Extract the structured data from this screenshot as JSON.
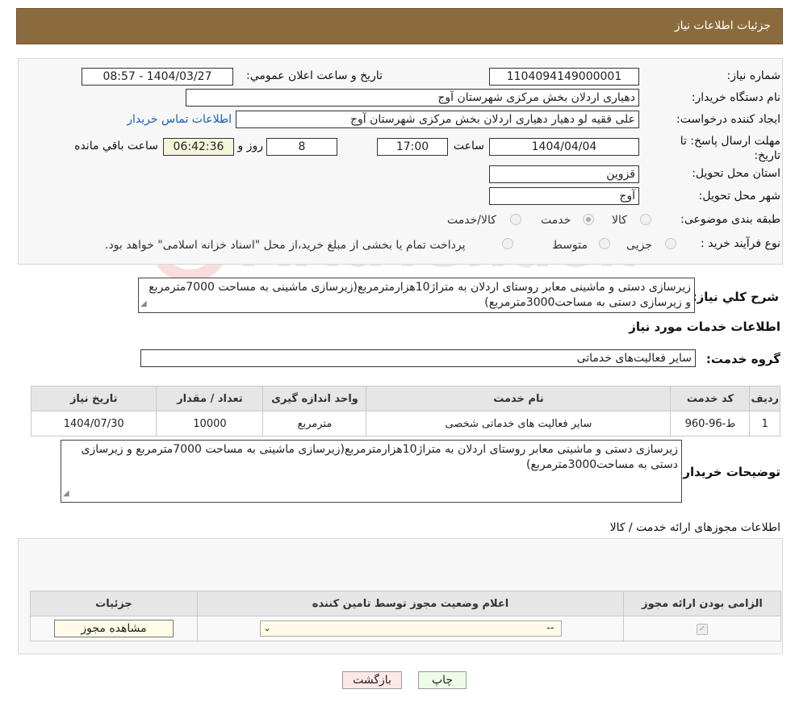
{
  "header": {
    "title": "جزئیات اطلاعات نیاز"
  },
  "form": {
    "need_number_label": "شماره نیاز:",
    "need_number": "1104094149000001",
    "announce_label": "تاریخ و ساعت اعلان عمومي:",
    "announce_value": "1404/03/27 - 08:57",
    "buyer_org_label": "نام دستگاه خریدار:",
    "buyer_org": "دهیاری اردلان بخش مرکزی شهرستان آوج",
    "requester_label": "ایجاد کننده درخواست:",
    "requester": "علی فقیه لو دهیار دهیاری اردلان بخش مرکزی شهرستان آوج",
    "contact_link": "اطلاعات تماس خریدار",
    "deadline_label": "مهلت ارسال پاسخ: تا تاریخ:",
    "deadline_date": "1404/04/04",
    "time_label": "ساعت",
    "deadline_time": "17:00",
    "days_value": "8",
    "days_label": "روز و",
    "remaining_time": "06:42:36",
    "remaining_label": "ساعت باقي مانده",
    "province_label": "استان محل تحویل:",
    "province": "قزوین",
    "city_label": "شهر محل تحویل:",
    "city": "آوج",
    "category_label": "طبقه بندی موضوعی:",
    "category_options": [
      "کالا",
      "خدمت",
      "کالا/خدمت"
    ],
    "category_selected": "خدمت",
    "purchase_type_label": "نوع فرآیند خرید :",
    "purchase_options": [
      "جزیی",
      "متوسط"
    ],
    "purchase_note": "پرداخت تمام یا بخشی از مبلغ خرید،از محل \"اسناد خزانه اسلامی\" خواهد بود."
  },
  "summary": {
    "label": "شرح کلي نیاز:",
    "text": "زیرسازی دستی و ماشینی معابر روستای اردلان به متراژ10هزارمترمربع(زیرسازی ماشینی به مساحت 7000مترمربع و زیرسازی دستی به مساحت3000مترمربع)"
  },
  "services": {
    "section_title": "اطلاعات خدمات مورد نیاز",
    "group_label": "گروه خدمت:",
    "group_value": "سایر فعالیت‌های خدماتی",
    "columns": [
      "ردیف",
      "کد خدمت",
      "نام خدمت",
      "واحد اندازه گیری",
      "تعداد / مقدار",
      "تاریخ نیاز"
    ],
    "rows": [
      [
        "1",
        "ط-96-960",
        "سایر فعالیت های خدماتی شخصی",
        "مترمربع",
        "10000",
        "1404/07/30"
      ]
    ]
  },
  "buyer_notes": {
    "label": "توضیحات خریدار:",
    "text": "زیرسازی دستی و ماشینی معابر روستای اردلان به متراژ10هزارمترمربع(زیرسازی ماشینی به مساحت 7000مترمربع و زیرسازی دستی به مساحت3000مترمربع)"
  },
  "permits": {
    "section_title": "اطلاعات مجوزهای ارائه خدمت / کالا",
    "columns": [
      "الزامی بودن ارائه مجوز",
      "اعلام وضعیت مجوز توسط تامین کننده",
      "جزئیات"
    ],
    "select_value": "--",
    "view_button": "مشاهده مجوز"
  },
  "buttons": {
    "print": "چاپ",
    "back": "بازگشت"
  },
  "colors": {
    "header_bg": "#8B6B3E",
    "back_btn_bg": "#fde8e8",
    "print_btn_bg": "#eefbe9",
    "link": "#1a5fb4"
  }
}
